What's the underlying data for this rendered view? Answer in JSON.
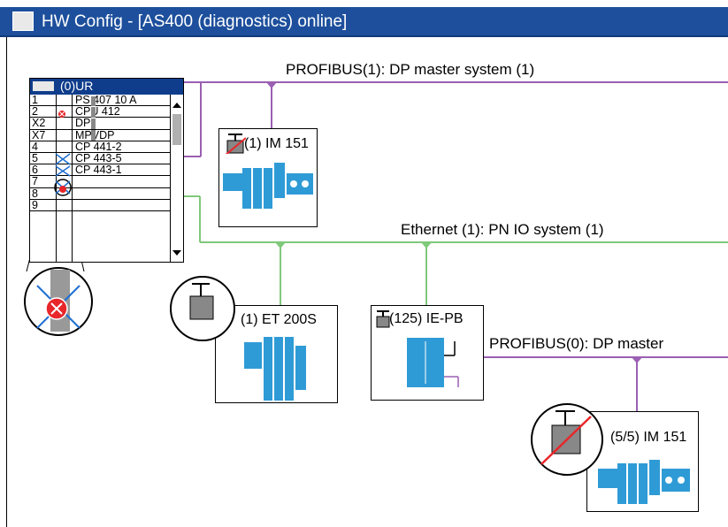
{
  "window": {
    "title": "HW Config - [AS400 (diagnostics) online]"
  },
  "rack": {
    "title": "(0)UR",
    "rows": [
      {
        "slot": "1",
        "module": "PS 407 10 A"
      },
      {
        "slot": "2",
        "module": "CPU 412"
      },
      {
        "slot": "X2",
        "module": "DP"
      },
      {
        "slot": "X7",
        "module": "MPVDP"
      },
      {
        "slot": "4",
        "module": "CP 441-2"
      },
      {
        "slot": "5",
        "module": "CP 443-5"
      },
      {
        "slot": "6",
        "module": "CP 443-1"
      },
      {
        "slot": "7",
        "module": ""
      },
      {
        "slot": "8",
        "module": ""
      },
      {
        "slot": "9",
        "module": ""
      }
    ]
  },
  "networks": {
    "profibus1": "PROFIBUS(1): DP master system (1)",
    "ethernet": "Ethernet (1): PN IO system (1)",
    "profibus0": "PROFIBUS(0): DP master"
  },
  "stations": {
    "im151_top": "(1) IM 151",
    "et200s": "(1) ET 200S",
    "iepb": "(125) IE-PB",
    "im151_bottom": "(5/5) IM 151"
  },
  "colors": {
    "titlebar": "#1d4f9c",
    "profibus": "#9b5fb3",
    "ethernet": "#7fc97a",
    "module": "#2f9bd6",
    "error": "#e8262a"
  }
}
